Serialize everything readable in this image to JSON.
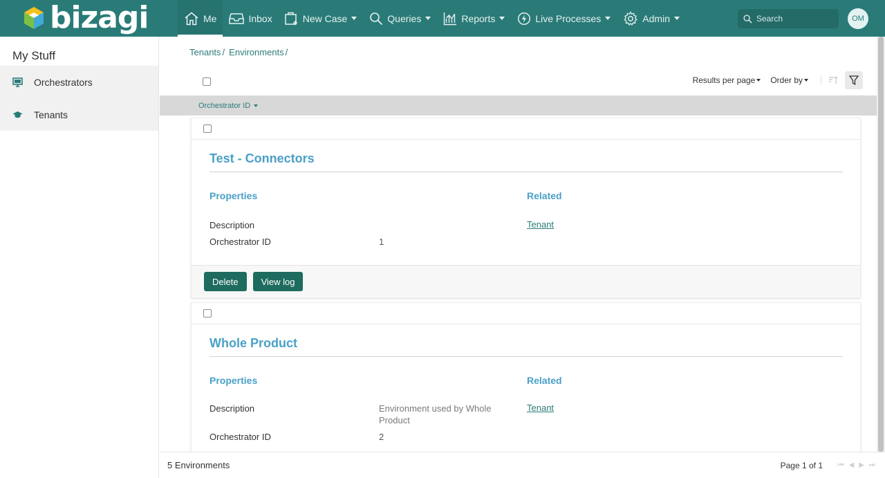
{
  "brand": {
    "name": "bizagi"
  },
  "nav": {
    "items": [
      {
        "label": "Me",
        "icon": "home-icon",
        "active": true
      },
      {
        "label": "Inbox",
        "icon": "inbox-icon"
      },
      {
        "label": "New Case",
        "icon": "new-case-icon"
      },
      {
        "label": "Queries",
        "icon": "search-icon"
      },
      {
        "label": "Reports",
        "icon": "reports-icon"
      },
      {
        "label": "Live Processes",
        "icon": "lightning-icon"
      },
      {
        "label": "Admin",
        "icon": "gear-icon"
      }
    ],
    "search_placeholder": "Search",
    "avatar_initials": "OM"
  },
  "sidebar": {
    "title": "My Stuff",
    "items": [
      {
        "label": "Orchestrators",
        "icon": "monitor-icon"
      },
      {
        "label": "Tenants",
        "icon": "graduation-cap-icon"
      }
    ]
  },
  "breadcrumb": [
    "Tenants",
    "Environments"
  ],
  "toolbar": {
    "results_per_page": "Results per page",
    "order_by": "Order by"
  },
  "group_by": "Orchestrator ID",
  "cards": [
    {
      "title": "Test - Connectors",
      "properties_label": "Properties",
      "related_label": "Related",
      "description_label": "Description",
      "description_value": "",
      "orchestrator_label": "Orchestrator ID",
      "orchestrator_value": "1",
      "related_link": "Tenant",
      "buttons": [
        "Delete",
        "View log"
      ]
    },
    {
      "title": "Whole Product",
      "properties_label": "Properties",
      "related_label": "Related",
      "description_label": "Description",
      "description_value": "Environment used by Whole Product",
      "orchestrator_label": "Orchestrator ID",
      "orchestrator_value": "2",
      "related_link": "Tenant"
    }
  ],
  "footer": {
    "count": "5 Environments",
    "page": "Page 1 of 1"
  },
  "colors": {
    "topbar": "#2a7b78",
    "accent_title": "#4aa0c7",
    "button": "#1e6b5f",
    "link": "#2a7b78"
  }
}
